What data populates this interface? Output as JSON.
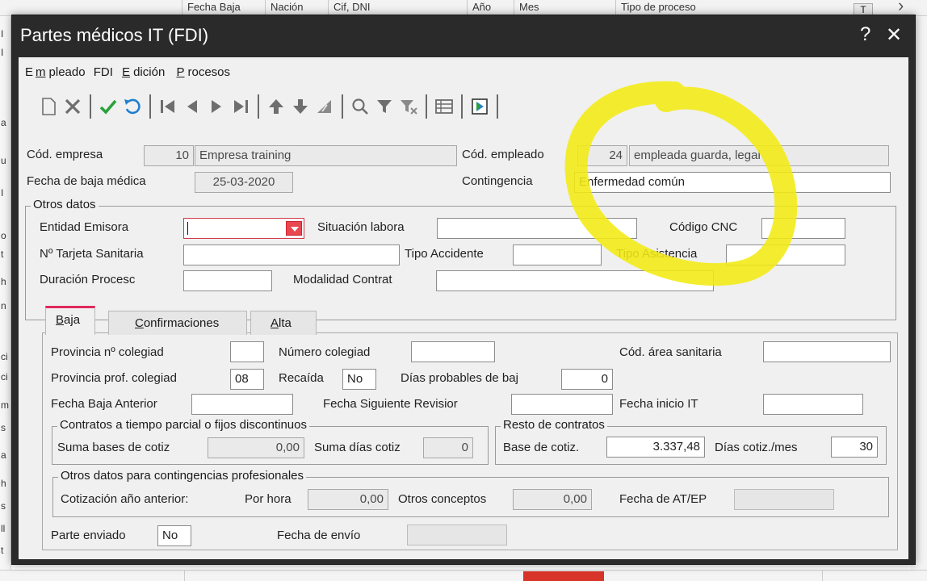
{
  "background": {
    "header_cols": [
      "Fecha Baja",
      "Nación",
      "Cif, DNI",
      "Año",
      "Mes",
      "Tipo de proceso"
    ],
    "left_edge_chars": [
      "I",
      "I",
      "a",
      "u",
      "I",
      "o",
      "t",
      "h",
      "n",
      "ci",
      "ci",
      "m",
      "s",
      "a",
      "h",
      "s",
      "ll",
      "t"
    ],
    "scroll_button": "T",
    "chevron": "›",
    "accent_red": "#d8342a"
  },
  "dialog": {
    "title": "Partes médicos IT (FDI)",
    "help_label": "?",
    "close_label": "✕",
    "title_bg": "#2a2a2a"
  },
  "menu": {
    "empleado": {
      "pre": "E",
      "ul": "m",
      "post": "pleado"
    },
    "fdi": {
      "pre": "FDI",
      "ul": "",
      "post": ""
    },
    "edicion": {
      "pre": "",
      "ul": "E",
      "post": "dición"
    },
    "procesos": {
      "pre": "",
      "ul": "P",
      "post": "rocesos"
    }
  },
  "toolbar": {
    "icons": [
      "new-icon",
      "delete-icon",
      "check-icon",
      "undo-icon",
      "first-record-icon",
      "prev-record-icon",
      "next-record-icon",
      "last-record-icon",
      "move-up-icon",
      "move-down-icon",
      "sort-icon",
      "search-icon",
      "filter-icon",
      "clear-filter-icon",
      "table-view-icon",
      "export-icon"
    ]
  },
  "header": {
    "cod_empresa_label": "Cód. empresa",
    "cod_empresa": "10",
    "empresa_nombre": "Empresa training",
    "cod_empleado_label": "Cód. empleado",
    "cod_empleado": "24",
    "empleado_nombre": "empleada guarda, legal",
    "fecha_baja_label": "Fecha de baja médica",
    "fecha_baja": "25-03-2020",
    "contingencia_label": "Contingencia",
    "contingencia": "Enfermedad común"
  },
  "otros_datos": {
    "title": "Otros datos",
    "entidad_label": "Entidad Emisora",
    "entidad": "",
    "situacion_label": "Situación labora",
    "situacion": "",
    "codigo_cnc_label": "Código CNC",
    "codigo_cnc": "",
    "tarjeta_label": "Nº Tarjeta Sanitaria",
    "tarjeta": "",
    "tipo_accidente_label": "Tipo Accidente",
    "tipo_accidente": "",
    "tipo_asistencia_label": "Tipo Asistencia",
    "tipo_asistencia": "",
    "duracion_label": "Duración Procesc",
    "duracion": "",
    "modalidad_label": "Modalidad Contrat",
    "modalidad": ""
  },
  "tabs": [
    {
      "label_ul": "B",
      "label_rest": "aja",
      "active": true
    },
    {
      "label_ul": "C",
      "label_rest": "onfirmaciones",
      "active": false
    },
    {
      "label_ul": "A",
      "label_rest": "lta",
      "active": false
    }
  ],
  "baja": {
    "prov_colegiado_label": "Provincia nº colegiad",
    "prov_colegiado": "",
    "num_colegiado_label": "Número colegiad",
    "num_colegiado": "",
    "cod_area_label": "Cód. área sanitaria",
    "cod_area": "",
    "prov_prof_label": "Provincia prof. colegiad",
    "prov_prof": "08",
    "recaida_label": "Recaída",
    "recaida": "No",
    "dias_prob_label": "Días probables de baj",
    "dias_prob": "0",
    "fecha_baja_ant_label": "Fecha Baja Anterior",
    "fecha_baja_ant": "",
    "fecha_sig_label": "Fecha Siguiente Revisior",
    "fecha_sig": "",
    "fecha_inicio_label": "Fecha inicio IT",
    "fecha_inicio": "",
    "contratos_title": "Contratos a tiempo parcial o fijos discontinuos",
    "suma_bases_label": "Suma bases de cotiz",
    "suma_bases": "0,00",
    "suma_dias_label": "Suma días cotiz",
    "suma_dias": "0",
    "resto_title": "Resto de contratos",
    "base_cotiz_label": "Base de cotiz.",
    "base_cotiz": "3.337,48",
    "dias_cotiz_label": "Días cotiz./mes",
    "dias_cotiz": "30",
    "otros_prof_title": "Otros datos para contingencias profesionales",
    "cot_anterior_label": "Cotización año anterior:",
    "por_hora_label": "Por hora",
    "por_hora": "0,00",
    "otros_conceptos_label": "Otros conceptos",
    "otros_conceptos": "0,00",
    "fecha_atep_label": "Fecha de AT/EP",
    "fecha_atep": "",
    "parte_enviado_label": "Parte enviado",
    "parte_enviado": "No",
    "fecha_envio_label": "Fecha de envío",
    "fecha_envio": ""
  },
  "annotation_color": "#f2ea12"
}
